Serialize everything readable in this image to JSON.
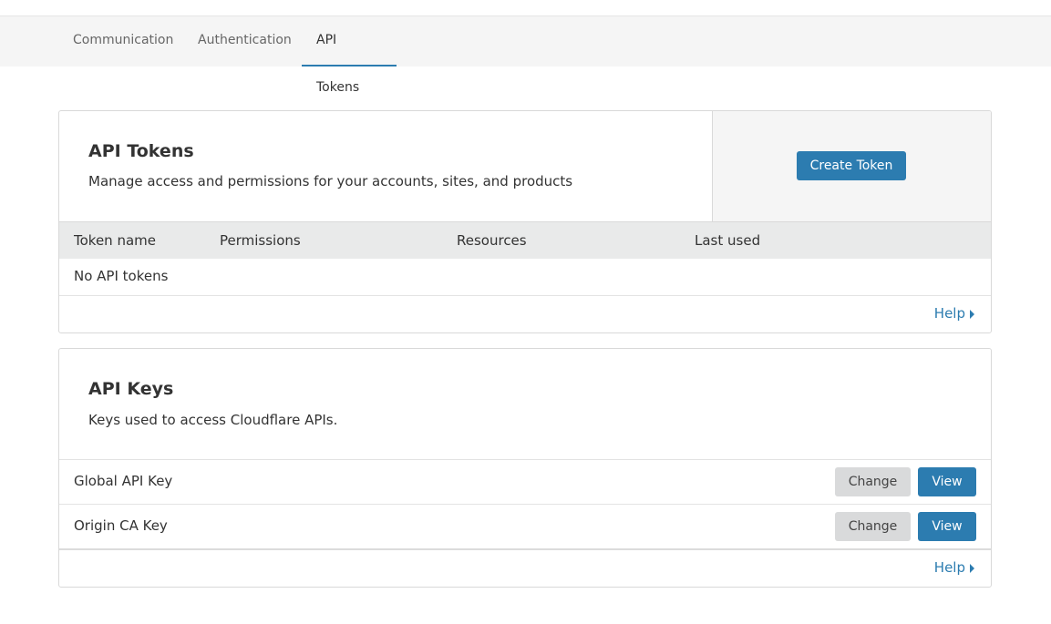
{
  "tabs": [
    {
      "label": "Communication"
    },
    {
      "label": "Authentication"
    },
    {
      "label": "API Tokens",
      "active": true
    }
  ],
  "tokens": {
    "title": "API Tokens",
    "subtitle": "Manage access and permissions for your accounts, sites, and products",
    "create_label": "Create Token",
    "columns": [
      "Token name",
      "Permissions",
      "Resources",
      "Last used"
    ],
    "empty": "No API tokens",
    "help": "Help"
  },
  "keys": {
    "title": "API Keys",
    "subtitle": "Keys used to access Cloudflare APIs.",
    "rows": [
      {
        "name": "Global API Key",
        "change": "Change",
        "view": "View"
      },
      {
        "name": "Origin CA Key",
        "change": "Change",
        "view": "View"
      }
    ],
    "help": "Help"
  },
  "colors": {
    "accent": "#2c7cb0"
  }
}
